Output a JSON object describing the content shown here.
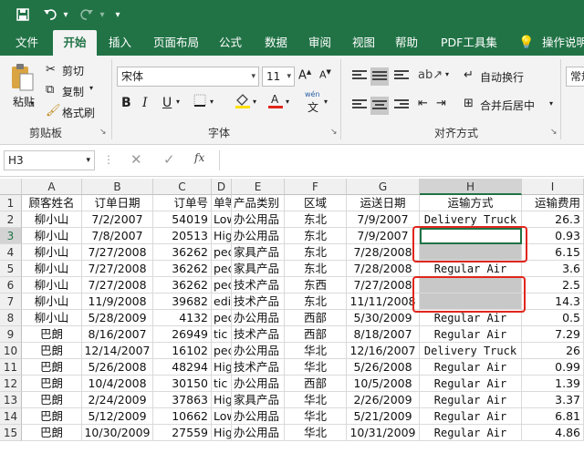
{
  "quick_access": {
    "save_icon": "save-icon",
    "undo_icon": "undo-icon",
    "redo_icon": "redo-icon",
    "customize_icon": "customize-icon"
  },
  "menu": {
    "tabs": [
      "文件",
      "开始",
      "插入",
      "页面布局",
      "公式",
      "数据",
      "审阅",
      "视图",
      "帮助",
      "PDF工具集",
      "操作说明"
    ],
    "active": "开始"
  },
  "ribbon": {
    "clipboard": {
      "paste": "粘贴",
      "cut": "剪切",
      "copy": "复制",
      "format_painter": "格式刷",
      "group": "剪贴板"
    },
    "font": {
      "name": "宋体",
      "size": "11",
      "bold": "B",
      "italic": "I",
      "underline": "U",
      "phonetic": "wén",
      "phonetic2": "文",
      "group": "字体",
      "font_color": "#e0261c",
      "fill_color": "#ffe000"
    },
    "alignment": {
      "wrap": "自动换行",
      "merge": "合并后居中",
      "group": "对齐方式"
    },
    "number": {
      "format": "常规"
    }
  },
  "formula_bar": {
    "name_box": "H3",
    "fx": "fx",
    "value": ""
  },
  "sheet": {
    "columns": [
      "A",
      "B",
      "C",
      "D",
      "E",
      "F",
      "G",
      "H",
      "I"
    ],
    "rows": [
      [
        "顾客姓名",
        "订单日期",
        "订单号",
        "单等",
        "产品类别",
        "区域",
        "运送日期",
        "运输方式",
        "运输费用"
      ],
      [
        "柳小山",
        "7/2/2007",
        "54019",
        "Low",
        "办公用品",
        "东北",
        "7/9/2007",
        "Delivery Truck",
        "26.3"
      ],
      [
        "柳小山",
        "7/8/2007",
        "20513",
        "Hig",
        "办公用品",
        "东北",
        "7/9/2007",
        "",
        "0.93"
      ],
      [
        "柳小山",
        "7/27/2008",
        "36262",
        "pec",
        "家具产品",
        "东北",
        "7/28/2008",
        "",
        "6.15"
      ],
      [
        "柳小山",
        "7/27/2008",
        "36262",
        "pec",
        "家具产品",
        "东北",
        "7/28/2008",
        "Regular Air",
        "3.6"
      ],
      [
        "柳小山",
        "7/27/2008",
        "36262",
        "pec",
        "技术产品",
        "东西",
        "7/27/2008",
        "",
        "2.5"
      ],
      [
        "柳小山",
        "11/9/2008",
        "39682",
        "edi",
        "技术产品",
        "东北",
        "11/11/2008",
        "",
        "14.3"
      ],
      [
        "柳小山",
        "5/28/2009",
        "4132",
        "pec",
        "办公用品",
        "西部",
        "5/30/2009",
        "Regular Air",
        "0.5"
      ],
      [
        "巴朗",
        "8/16/2007",
        "26949",
        "tic",
        "技术产品",
        "西部",
        "8/18/2007",
        "Regular Air",
        "7.29"
      ],
      [
        "巴朗",
        "12/14/2007",
        "16102",
        "pec",
        "办公用品",
        "华北",
        "12/16/2007",
        "Delivery Truck",
        "26"
      ],
      [
        "巴朗",
        "5/26/2008",
        "48294",
        "Hig",
        "技术产品",
        "华北",
        "5/26/2008",
        "Regular Air",
        "0.99"
      ],
      [
        "巴朗",
        "10/4/2008",
        "30150",
        "tic",
        "办公用品",
        "西部",
        "10/5/2008",
        "Regular Air",
        "1.39"
      ],
      [
        "巴朗",
        "2/24/2009",
        "37863",
        "Hig",
        "家具产品",
        "华北",
        "2/26/2009",
        "Regular Air",
        "3.37"
      ],
      [
        "巴朗",
        "5/12/2009",
        "10662",
        "Low",
        "办公用品",
        "华北",
        "5/21/2009",
        "Regular Air",
        "6.81"
      ],
      [
        "巴朗",
        "10/30/2009",
        "27559",
        "Hig",
        "办公用品",
        "华北",
        "10/31/2009",
        "Regular Air",
        "4.86"
      ]
    ]
  }
}
